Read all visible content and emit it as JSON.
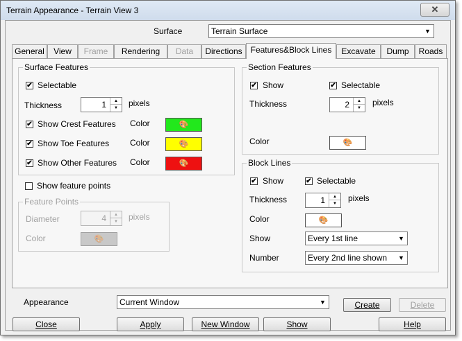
{
  "window": {
    "title": "Terrain Appearance - Terrain View 3",
    "close_glyph": "✕"
  },
  "surface": {
    "label": "Surface",
    "value": "Terrain Surface"
  },
  "tabs": [
    {
      "label": "General",
      "enabled": true
    },
    {
      "label": "View",
      "enabled": true
    },
    {
      "label": "Frame",
      "enabled": false
    },
    {
      "label": "Rendering",
      "enabled": true
    },
    {
      "label": "Data",
      "enabled": false
    },
    {
      "label": "Directions",
      "enabled": true
    },
    {
      "label": "Features&Block Lines",
      "enabled": true,
      "active": true
    },
    {
      "label": "Excavate",
      "enabled": true
    },
    {
      "label": "Dump",
      "enabled": true
    },
    {
      "label": "Roads",
      "enabled": true
    }
  ],
  "surface_features": {
    "title": "Surface Features",
    "selectable": {
      "label": "Selectable",
      "checked": true
    },
    "thickness": {
      "label": "Thickness",
      "value": "1",
      "unit": "pixels"
    },
    "color_label": "Color",
    "rows": [
      {
        "label": "Show Crest Features",
        "checked": true,
        "color": "#22e81c"
      },
      {
        "label": "Show Toe Features",
        "checked": true,
        "color": "#ffff00"
      },
      {
        "label": "Show Other Features",
        "checked": true,
        "color": "#ee1111"
      }
    ]
  },
  "show_feature_points": {
    "label": "Show feature points",
    "checked": false
  },
  "feature_points": {
    "title": "Feature Points",
    "diameter": {
      "label": "Diameter",
      "value": "4",
      "unit": "pixels"
    },
    "color_label": "Color"
  },
  "section_features": {
    "title": "Section Features",
    "show": {
      "label": "Show",
      "checked": true
    },
    "selectable": {
      "label": "Selectable",
      "checked": true
    },
    "thickness": {
      "label": "Thickness",
      "value": "2",
      "unit": "pixels"
    },
    "color_label": "Color"
  },
  "block_lines": {
    "title": "Block Lines",
    "show": {
      "label": "Show",
      "checked": true
    },
    "selectable": {
      "label": "Selectable",
      "checked": true
    },
    "thickness": {
      "label": "Thickness",
      "value": "1",
      "unit": "pixels"
    },
    "color_label": "Color",
    "show_label": "Show",
    "show_value": "Every  1st line",
    "number_label": "Number",
    "number_value": "Every  2nd line shown"
  },
  "appearance": {
    "label": "Appearance",
    "value": "Current Window",
    "create": "Create",
    "delete": "Delete"
  },
  "buttons": {
    "close": "Close",
    "apply": "Apply",
    "new_window": "New Window",
    "show": "Show",
    "help": "Help"
  }
}
